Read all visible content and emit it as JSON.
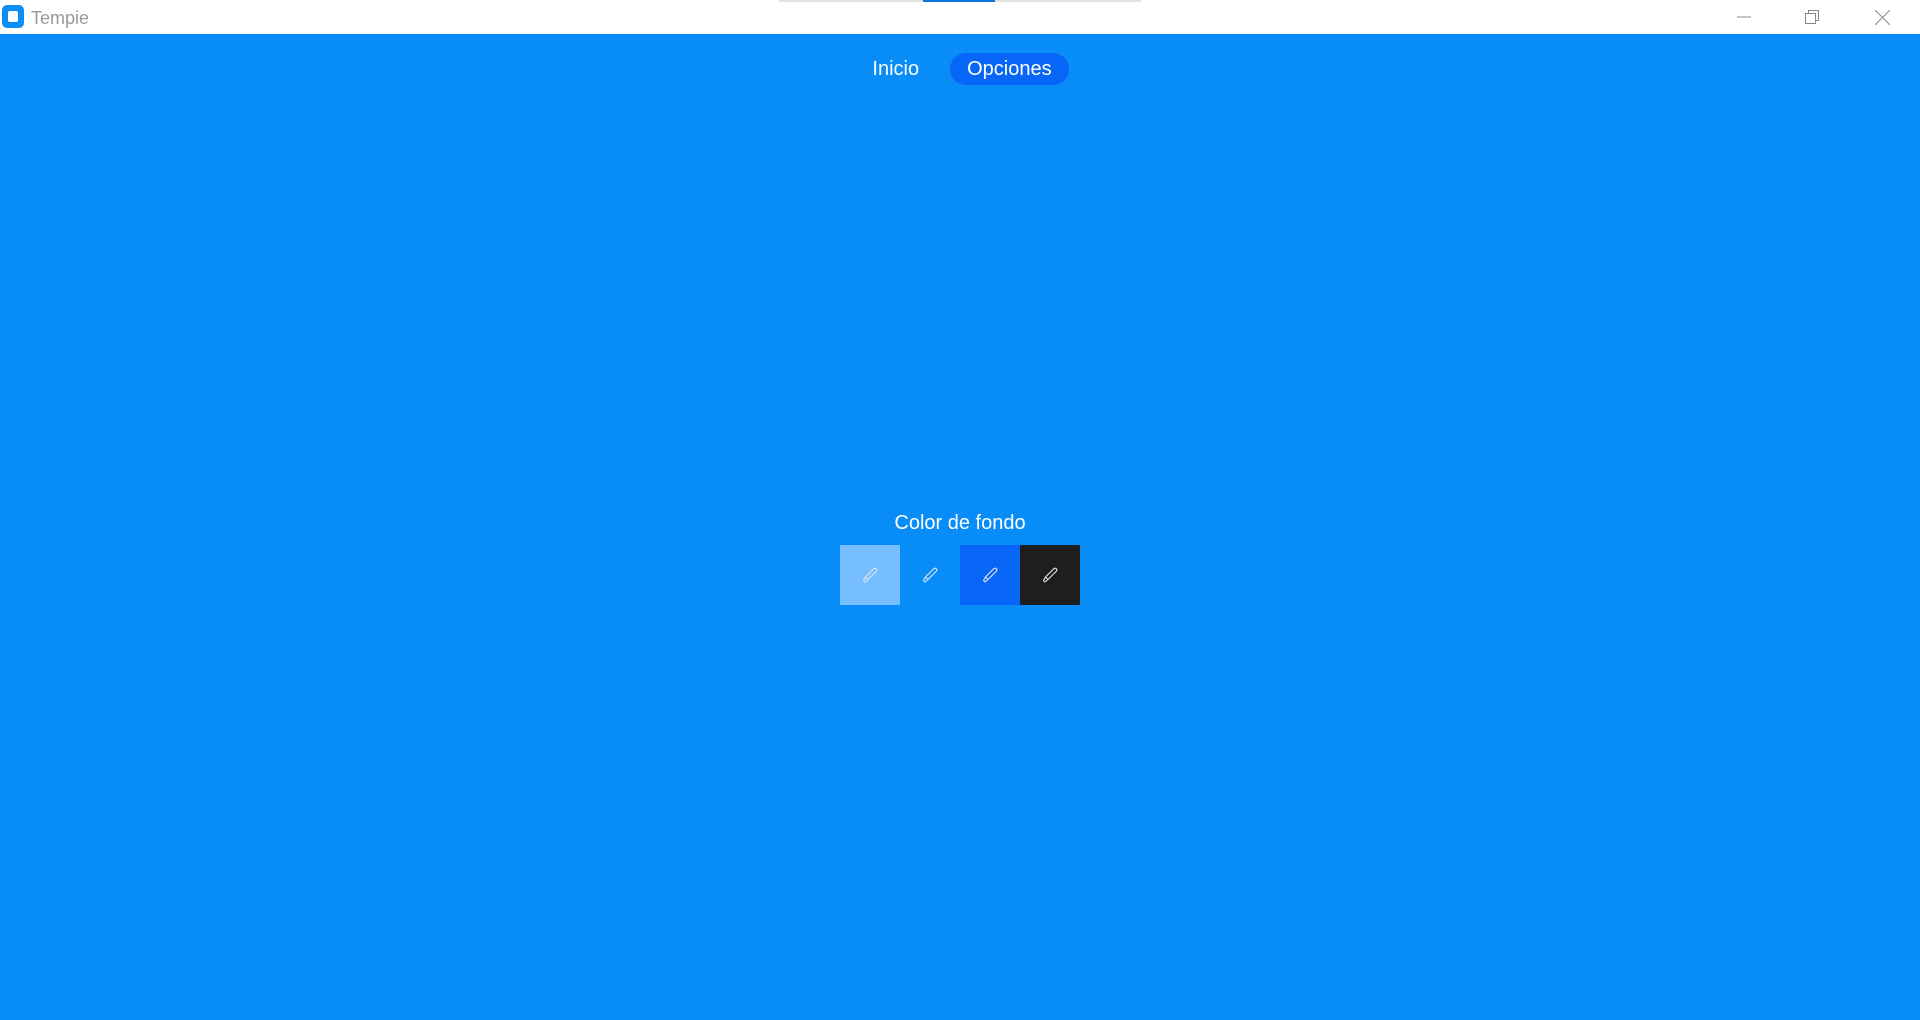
{
  "window": {
    "title": "Tempie",
    "loading_progress": 0.2
  },
  "nav": {
    "items": [
      {
        "label": "Inicio",
        "active": false
      },
      {
        "label": "Opciones",
        "active": true
      }
    ]
  },
  "options": {
    "background_section_title": "Color de fondo",
    "swatches": [
      {
        "color": "#76beff",
        "icon": "brush-icon"
      },
      {
        "color": "#078cf8",
        "icon": "brush-icon"
      },
      {
        "color": "#0866f6",
        "icon": "brush-icon"
      },
      {
        "color": "#1e1e1e",
        "icon": "brush-icon"
      }
    ]
  },
  "colors": {
    "background": "#078cf8",
    "accent": "#0866f6"
  }
}
